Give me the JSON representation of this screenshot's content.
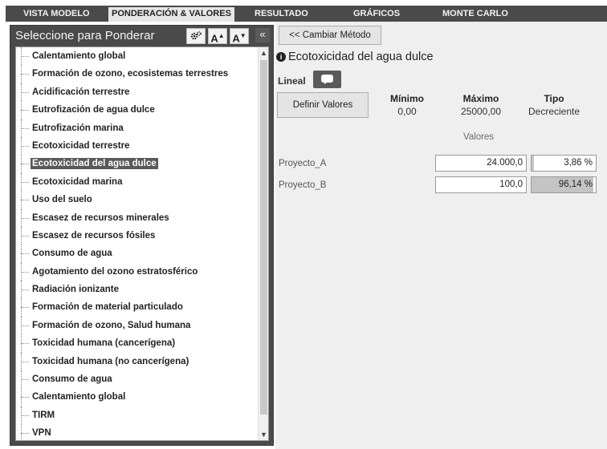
{
  "tabs": [
    {
      "label": "VISTA MODELO",
      "active": false
    },
    {
      "label": "PONDERACIÓN & VALORES",
      "active": true
    },
    {
      "label": "RESULTADO",
      "active": false
    },
    {
      "label": "GRÁFICOS",
      "active": false
    },
    {
      "label": "MONTE CARLO",
      "active": false
    }
  ],
  "left_panel": {
    "title": "Seleccione para Ponderar",
    "tools": {
      "settings_icon": "gears-icon",
      "font_increase_label": "A",
      "font_decrease_label": "A",
      "collapse_label": "«"
    },
    "items": [
      "Calentamiento global",
      "Formación de ozono, ecosistemas terrestres",
      "Acidificación terrestre",
      "Eutrofización de agua dulce",
      "Eutrofización marina",
      "Ecotoxicidad terrestre",
      "Ecotoxicidad del agua dulce",
      "Ecotoxicidad marina",
      "Uso del suelo",
      "Escasez de recursos minerales",
      "Escasez de recursos fósiles",
      "Consumo de agua",
      "Agotamiento del ozono estratosférico",
      "Radiación ionizante",
      "Formación de material particulado",
      "Formación de ozono, Salud humana",
      "Toxicidad humana (cancerígena)",
      "Toxicidad humana (no cancerígena)",
      "Consumo de agua",
      "Calentamiento global",
      "TIRM",
      "VPN"
    ],
    "selected_index": 6
  },
  "right_panel": {
    "change_method_label": "<< Cambiar Método",
    "heading": "Ecotoxicidad del agua dulce",
    "method_label": "Lineal",
    "define_values_label": "Definir Valores",
    "columns": {
      "min_header": "Mínimo",
      "min_value": "0,00",
      "max_header": "Máximo",
      "max_value": "25000,00",
      "type_header": "Tipo",
      "type_value": "Decreciente"
    },
    "values_label": "Valores",
    "projects": [
      {
        "name": "Proyecto_A",
        "value": "24.000,0",
        "percent": "3,86 %",
        "fraction": 0.0386
      },
      {
        "name": "Proyecto_B",
        "value": "100,0",
        "percent": "96,14 %",
        "fraction": 0.9614
      }
    ]
  }
}
